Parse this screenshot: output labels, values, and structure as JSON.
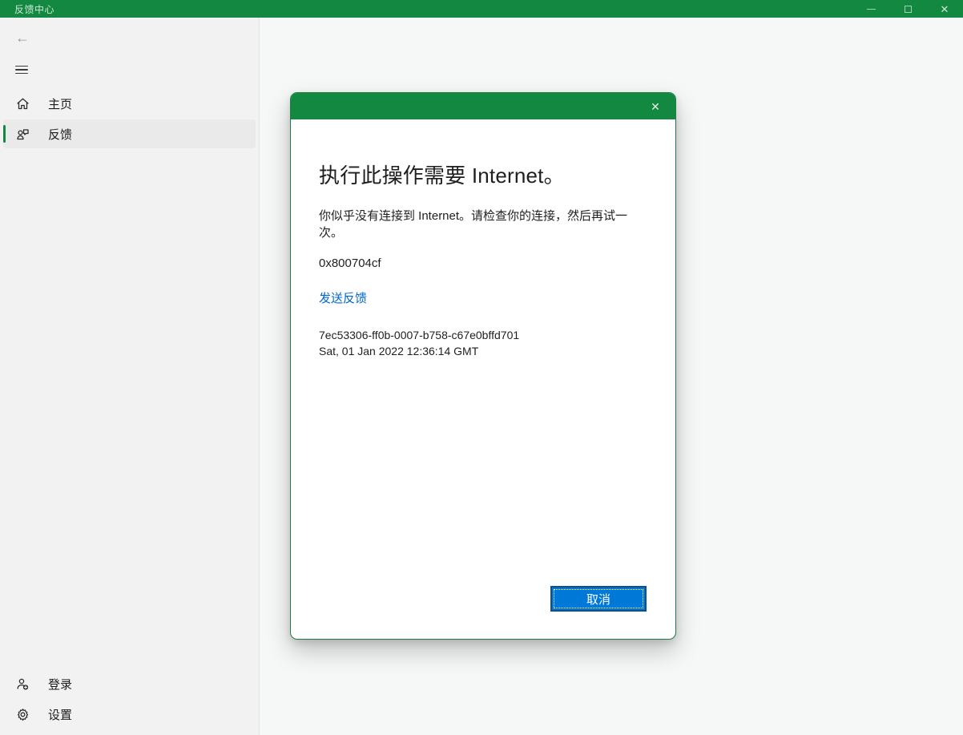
{
  "window": {
    "title": "反馈中心",
    "close_glyph": "✕"
  },
  "sidebar": {
    "items": [
      {
        "label": "主页",
        "icon": "home-icon",
        "selected": false
      },
      {
        "label": "反馈",
        "icon": "feedback-icon",
        "selected": true
      }
    ],
    "footer_items": [
      {
        "label": "登录",
        "icon": "person-add-icon"
      },
      {
        "label": "设置",
        "icon": "gear-icon"
      }
    ]
  },
  "dialog": {
    "close_glyph": "✕",
    "title": "执行此操作需要 Internet。",
    "body": "你似乎没有连接到 Internet。请检查你的连接，然后再试一次。",
    "error_code": "0x800704cf",
    "link_label": "发送反馈",
    "guid": "7ec53306-ff0b-0007-b758-c67e0bffd701",
    "timestamp": "Sat, 01 Jan 2022 12:36:14 GMT",
    "cancel_label": "取消"
  },
  "colors": {
    "accent_green": "#128841",
    "button_blue": "#0078d7",
    "link_blue": "#0066cc"
  }
}
